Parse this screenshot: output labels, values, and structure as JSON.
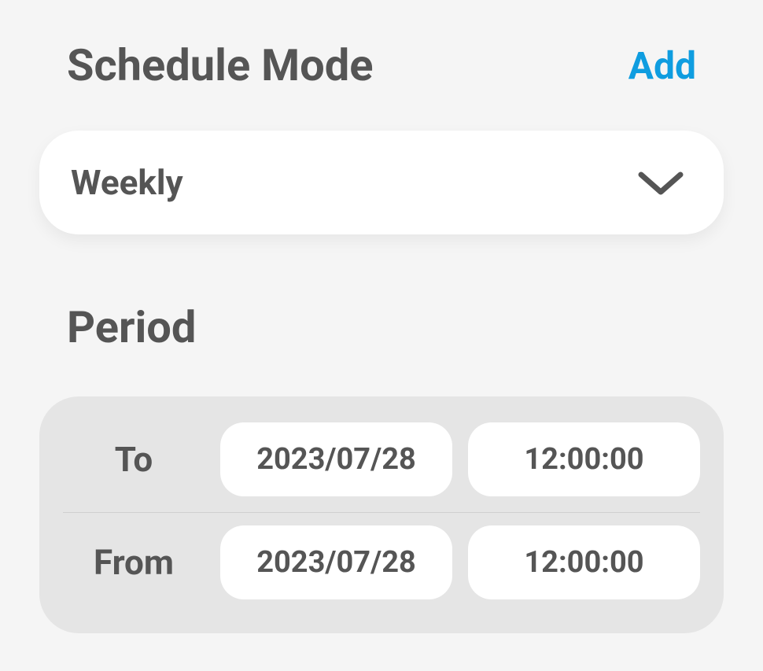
{
  "scheduleMode": {
    "title": "Schedule Mode",
    "addLabel": "Add",
    "dropdown": {
      "selected": "Weekly"
    }
  },
  "period": {
    "title": "Period",
    "rows": [
      {
        "label": "To",
        "date": "2023/07/28",
        "time": "12:00:00"
      },
      {
        "label": "From",
        "date": "2023/07/28",
        "time": "12:00:00"
      }
    ]
  }
}
